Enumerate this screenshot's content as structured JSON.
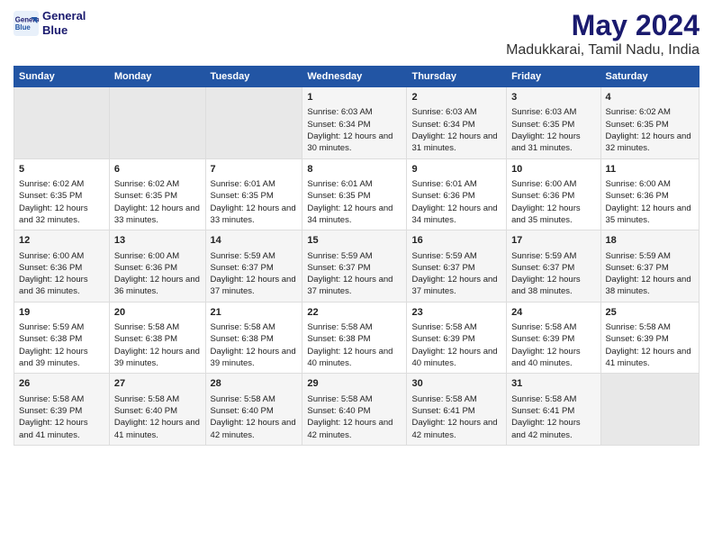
{
  "logo": {
    "line1": "General",
    "line2": "Blue"
  },
  "title": "May 2024",
  "subtitle": "Madukkarai, Tamil Nadu, India",
  "headers": [
    "Sunday",
    "Monday",
    "Tuesday",
    "Wednesday",
    "Thursday",
    "Friday",
    "Saturday"
  ],
  "weeks": [
    [
      {
        "day": "",
        "sunrise": "",
        "sunset": "",
        "daylight": "",
        "empty": true
      },
      {
        "day": "",
        "sunrise": "",
        "sunset": "",
        "daylight": "",
        "empty": true
      },
      {
        "day": "",
        "sunrise": "",
        "sunset": "",
        "daylight": "",
        "empty": true
      },
      {
        "day": "1",
        "sunrise": "Sunrise: 6:03 AM",
        "sunset": "Sunset: 6:34 PM",
        "daylight": "Daylight: 12 hours and 30 minutes."
      },
      {
        "day": "2",
        "sunrise": "Sunrise: 6:03 AM",
        "sunset": "Sunset: 6:34 PM",
        "daylight": "Daylight: 12 hours and 31 minutes."
      },
      {
        "day": "3",
        "sunrise": "Sunrise: 6:03 AM",
        "sunset": "Sunset: 6:35 PM",
        "daylight": "Daylight: 12 hours and 31 minutes."
      },
      {
        "day": "4",
        "sunrise": "Sunrise: 6:02 AM",
        "sunset": "Sunset: 6:35 PM",
        "daylight": "Daylight: 12 hours and 32 minutes."
      }
    ],
    [
      {
        "day": "5",
        "sunrise": "Sunrise: 6:02 AM",
        "sunset": "Sunset: 6:35 PM",
        "daylight": "Daylight: 12 hours and 32 minutes."
      },
      {
        "day": "6",
        "sunrise": "Sunrise: 6:02 AM",
        "sunset": "Sunset: 6:35 PM",
        "daylight": "Daylight: 12 hours and 33 minutes."
      },
      {
        "day": "7",
        "sunrise": "Sunrise: 6:01 AM",
        "sunset": "Sunset: 6:35 PM",
        "daylight": "Daylight: 12 hours and 33 minutes."
      },
      {
        "day": "8",
        "sunrise": "Sunrise: 6:01 AM",
        "sunset": "Sunset: 6:35 PM",
        "daylight": "Daylight: 12 hours and 34 minutes."
      },
      {
        "day": "9",
        "sunrise": "Sunrise: 6:01 AM",
        "sunset": "Sunset: 6:36 PM",
        "daylight": "Daylight: 12 hours and 34 minutes."
      },
      {
        "day": "10",
        "sunrise": "Sunrise: 6:00 AM",
        "sunset": "Sunset: 6:36 PM",
        "daylight": "Daylight: 12 hours and 35 minutes."
      },
      {
        "day": "11",
        "sunrise": "Sunrise: 6:00 AM",
        "sunset": "Sunset: 6:36 PM",
        "daylight": "Daylight: 12 hours and 35 minutes."
      }
    ],
    [
      {
        "day": "12",
        "sunrise": "Sunrise: 6:00 AM",
        "sunset": "Sunset: 6:36 PM",
        "daylight": "Daylight: 12 hours and 36 minutes."
      },
      {
        "day": "13",
        "sunrise": "Sunrise: 6:00 AM",
        "sunset": "Sunset: 6:36 PM",
        "daylight": "Daylight: 12 hours and 36 minutes."
      },
      {
        "day": "14",
        "sunrise": "Sunrise: 5:59 AM",
        "sunset": "Sunset: 6:37 PM",
        "daylight": "Daylight: 12 hours and 37 minutes."
      },
      {
        "day": "15",
        "sunrise": "Sunrise: 5:59 AM",
        "sunset": "Sunset: 6:37 PM",
        "daylight": "Daylight: 12 hours and 37 minutes."
      },
      {
        "day": "16",
        "sunrise": "Sunrise: 5:59 AM",
        "sunset": "Sunset: 6:37 PM",
        "daylight": "Daylight: 12 hours and 37 minutes."
      },
      {
        "day": "17",
        "sunrise": "Sunrise: 5:59 AM",
        "sunset": "Sunset: 6:37 PM",
        "daylight": "Daylight: 12 hours and 38 minutes."
      },
      {
        "day": "18",
        "sunrise": "Sunrise: 5:59 AM",
        "sunset": "Sunset: 6:37 PM",
        "daylight": "Daylight: 12 hours and 38 minutes."
      }
    ],
    [
      {
        "day": "19",
        "sunrise": "Sunrise: 5:59 AM",
        "sunset": "Sunset: 6:38 PM",
        "daylight": "Daylight: 12 hours and 39 minutes."
      },
      {
        "day": "20",
        "sunrise": "Sunrise: 5:58 AM",
        "sunset": "Sunset: 6:38 PM",
        "daylight": "Daylight: 12 hours and 39 minutes."
      },
      {
        "day": "21",
        "sunrise": "Sunrise: 5:58 AM",
        "sunset": "Sunset: 6:38 PM",
        "daylight": "Daylight: 12 hours and 39 minutes."
      },
      {
        "day": "22",
        "sunrise": "Sunrise: 5:58 AM",
        "sunset": "Sunset: 6:38 PM",
        "daylight": "Daylight: 12 hours and 40 minutes."
      },
      {
        "day": "23",
        "sunrise": "Sunrise: 5:58 AM",
        "sunset": "Sunset: 6:39 PM",
        "daylight": "Daylight: 12 hours and 40 minutes."
      },
      {
        "day": "24",
        "sunrise": "Sunrise: 5:58 AM",
        "sunset": "Sunset: 6:39 PM",
        "daylight": "Daylight: 12 hours and 40 minutes."
      },
      {
        "day": "25",
        "sunrise": "Sunrise: 5:58 AM",
        "sunset": "Sunset: 6:39 PM",
        "daylight": "Daylight: 12 hours and 41 minutes."
      }
    ],
    [
      {
        "day": "26",
        "sunrise": "Sunrise: 5:58 AM",
        "sunset": "Sunset: 6:39 PM",
        "daylight": "Daylight: 12 hours and 41 minutes."
      },
      {
        "day": "27",
        "sunrise": "Sunrise: 5:58 AM",
        "sunset": "Sunset: 6:40 PM",
        "daylight": "Daylight: 12 hours and 41 minutes."
      },
      {
        "day": "28",
        "sunrise": "Sunrise: 5:58 AM",
        "sunset": "Sunset: 6:40 PM",
        "daylight": "Daylight: 12 hours and 42 minutes."
      },
      {
        "day": "29",
        "sunrise": "Sunrise: 5:58 AM",
        "sunset": "Sunset: 6:40 PM",
        "daylight": "Daylight: 12 hours and 42 minutes."
      },
      {
        "day": "30",
        "sunrise": "Sunrise: 5:58 AM",
        "sunset": "Sunset: 6:41 PM",
        "daylight": "Daylight: 12 hours and 42 minutes."
      },
      {
        "day": "31",
        "sunrise": "Sunrise: 5:58 AM",
        "sunset": "Sunset: 6:41 PM",
        "daylight": "Daylight: 12 hours and 42 minutes."
      },
      {
        "day": "",
        "sunrise": "",
        "sunset": "",
        "daylight": "",
        "empty": true
      }
    ]
  ]
}
